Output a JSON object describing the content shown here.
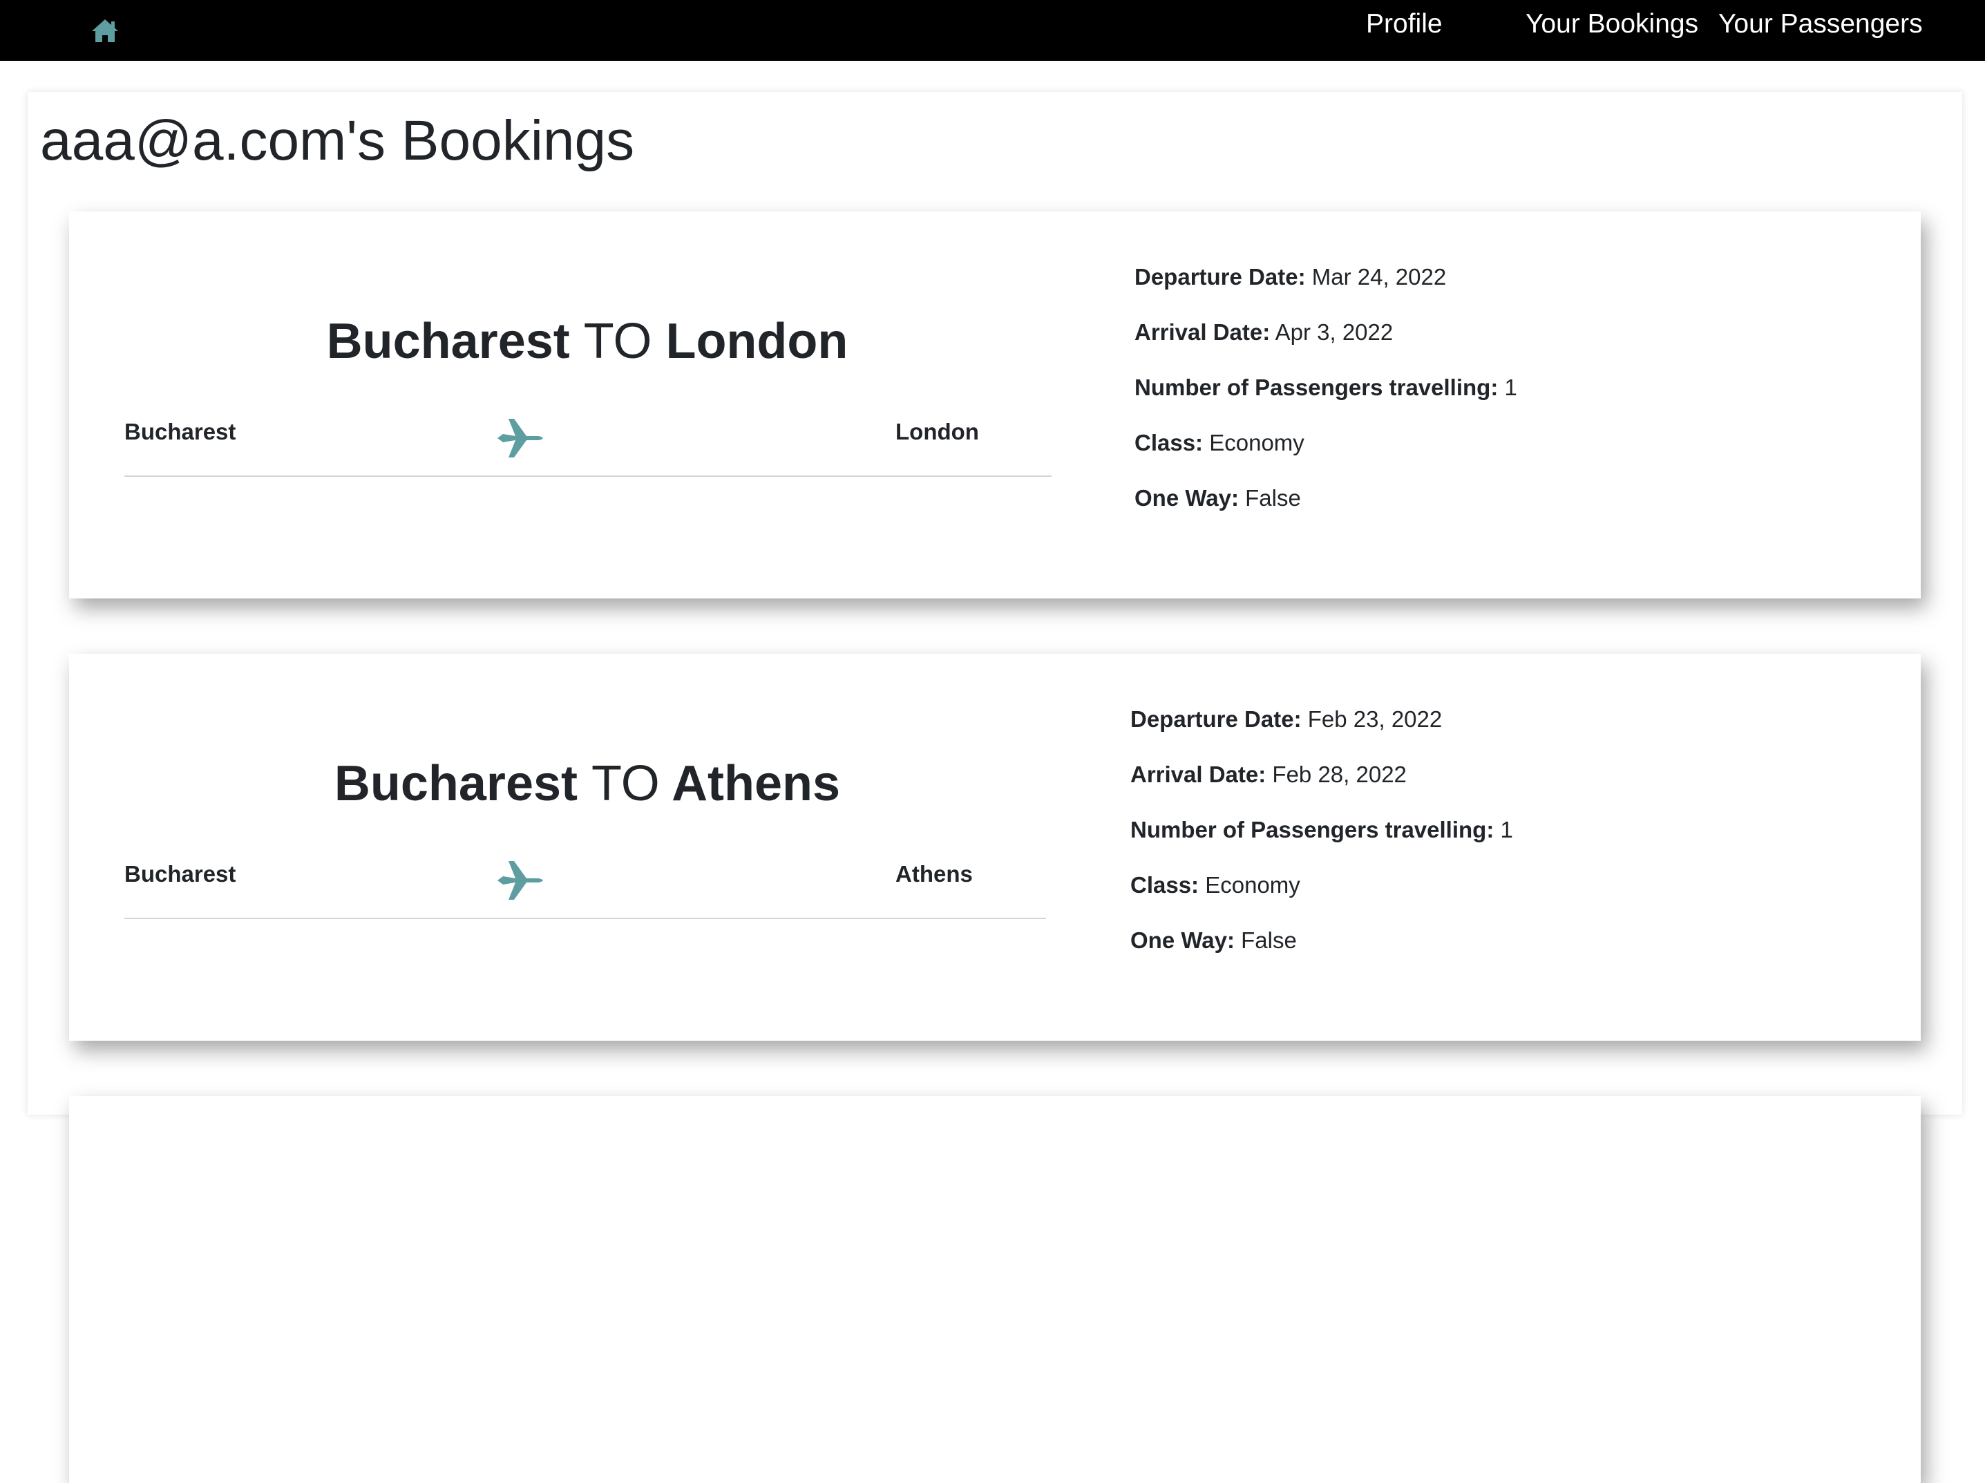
{
  "nav": {
    "home_icon": "home-icon",
    "links": [
      "Profile",
      "Your Bookings",
      "Your Passengers"
    ]
  },
  "page": {
    "title": "aaa@a.com's Bookings"
  },
  "colors": {
    "navbar_bg": "#000000",
    "icon_teal": "#5f9ea0",
    "text": "#212529"
  },
  "bookings": [
    {
      "from": "Bucharest",
      "to_word": "TO",
      "to": "London",
      "plane_icon": "airplane-icon",
      "details": [
        {
          "label": "Departure Date:",
          "value": "Mar 24, 2022"
        },
        {
          "label": "Arrival Date:",
          "value": "Apr 3, 2022"
        },
        {
          "label": "Number of Passengers travelling:",
          "value": "1"
        },
        {
          "label": "Class:",
          "value": "Economy"
        },
        {
          "label": "One Way:",
          "value": "False"
        }
      ]
    },
    {
      "from": "Bucharest",
      "to_word": "TO",
      "to": "Athens",
      "plane_icon": "airplane-icon",
      "details": [
        {
          "label": "Departure Date:",
          "value": "Feb 23, 2022"
        },
        {
          "label": "Arrival Date:",
          "value": "Feb 28, 2022"
        },
        {
          "label": "Number of Passengers travelling:",
          "value": "1"
        },
        {
          "label": "Class:",
          "value": "Economy"
        },
        {
          "label": "One Way:",
          "value": "False"
        }
      ]
    }
  ]
}
